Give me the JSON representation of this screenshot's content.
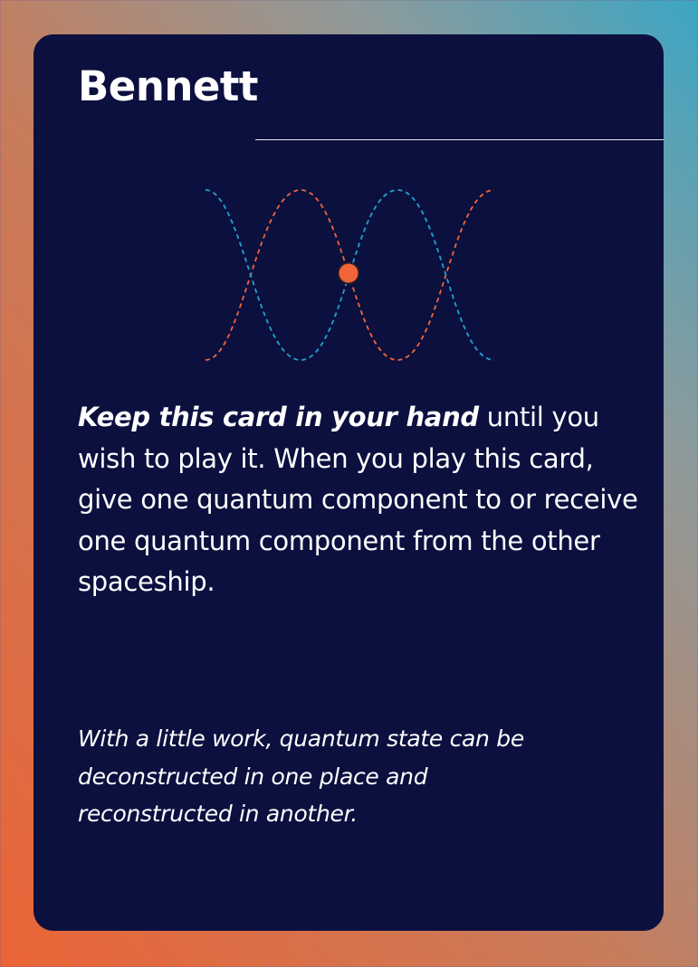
{
  "card": {
    "title": "Bennett",
    "rule_emphasis": "Keep this card in your hand",
    "rule_text": " until you wish to play it. When you play this card, give one quantum component to or receive one quantum component from the other spaceship.",
    "flavor_text": "With a little work, quantum state can be deconstructed in one place and reconstructed in another."
  },
  "art": {
    "description_icon": "dashed-sine-waves-icon",
    "colors": {
      "wave_a": "#f2643a",
      "wave_b": "#1fa3cf",
      "dot": "#f2643a"
    }
  },
  "colors": {
    "card_background": "#0c103f",
    "text": "#ffffff",
    "gradient_start": "#ea6436",
    "gradient_end": "#3ca6c4"
  }
}
